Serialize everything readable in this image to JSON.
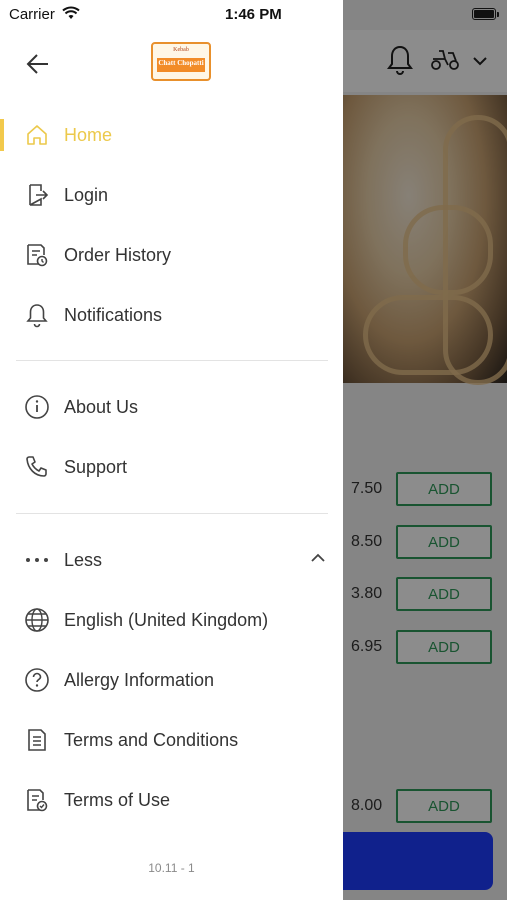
{
  "status_bar": {
    "carrier": "Carrier",
    "time": "1:46 PM"
  },
  "drawer": {
    "menu_primary": [
      {
        "label": "Home",
        "icon": "home-icon",
        "active": true
      },
      {
        "label": "Login",
        "icon": "login-icon"
      },
      {
        "label": "Order History",
        "icon": "order-history-icon"
      },
      {
        "label": "Notifications",
        "icon": "bell-icon"
      }
    ],
    "menu_secondary": [
      {
        "label": "About Us",
        "icon": "info-icon"
      },
      {
        "label": "Support",
        "icon": "phone-icon"
      }
    ],
    "less_toggle": {
      "label": "Less",
      "icon": "more-dots-icon"
    },
    "menu_more": [
      {
        "label": "English (United Kingdom)",
        "icon": "globe-icon"
      },
      {
        "label": "Allergy Information",
        "icon": "help-circle-icon"
      },
      {
        "label": "Terms and Conditions",
        "icon": "document-icon"
      },
      {
        "label": "Terms of Use",
        "icon": "document-check-icon"
      }
    ],
    "version": "10.11 - 1"
  },
  "background": {
    "prices": [
      "7.50",
      "8.50",
      "3.80",
      "6.95",
      "8.00"
    ],
    "add_label": "ADD"
  },
  "colors": {
    "accent": "#ecc94b",
    "add_green": "#2f9a5a",
    "cta_blue": "#1e3cff"
  }
}
